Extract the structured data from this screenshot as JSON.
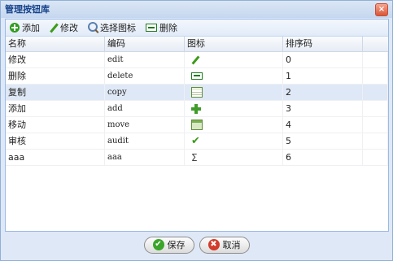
{
  "window": {
    "title": "管理按钮库",
    "close_glyph": "×"
  },
  "toolbar": {
    "add_label": "添加",
    "edit_label": "修改",
    "choose_icon_label": "选择图标",
    "delete_label": "删除"
  },
  "grid": {
    "headers": {
      "name": "名称",
      "code": "编码",
      "icon": "图标",
      "order": "排序码"
    },
    "rows": [
      {
        "name": "修改",
        "code": "edit",
        "icon": "pencil-icon",
        "order": "0"
      },
      {
        "name": "删除",
        "code": "delete",
        "icon": "minus-box-icon",
        "order": "1"
      },
      {
        "name": "复制",
        "code": "copy",
        "icon": "table-icon",
        "order": "2",
        "selected": true
      },
      {
        "name": "添加",
        "code": "add",
        "icon": "plus-icon",
        "order": "3"
      },
      {
        "name": "移动",
        "code": "move",
        "icon": "window-icon",
        "order": "4"
      },
      {
        "name": "审核",
        "code": "audit",
        "icon": "checkmark-icon",
        "order": "5",
        "glyph": "✔"
      },
      {
        "name": "aaa",
        "code": "aaa",
        "icon": "sigma-icon",
        "order": "6",
        "glyph": "Σ"
      }
    ]
  },
  "footer": {
    "save_label": "保存",
    "cancel_label": "取消",
    "save_glyph": "✔",
    "cancel_glyph": "✖"
  },
  "colors": {
    "title_text": "#15428b",
    "border": "#99bbe8",
    "selected_row": "#dfe8f6"
  }
}
